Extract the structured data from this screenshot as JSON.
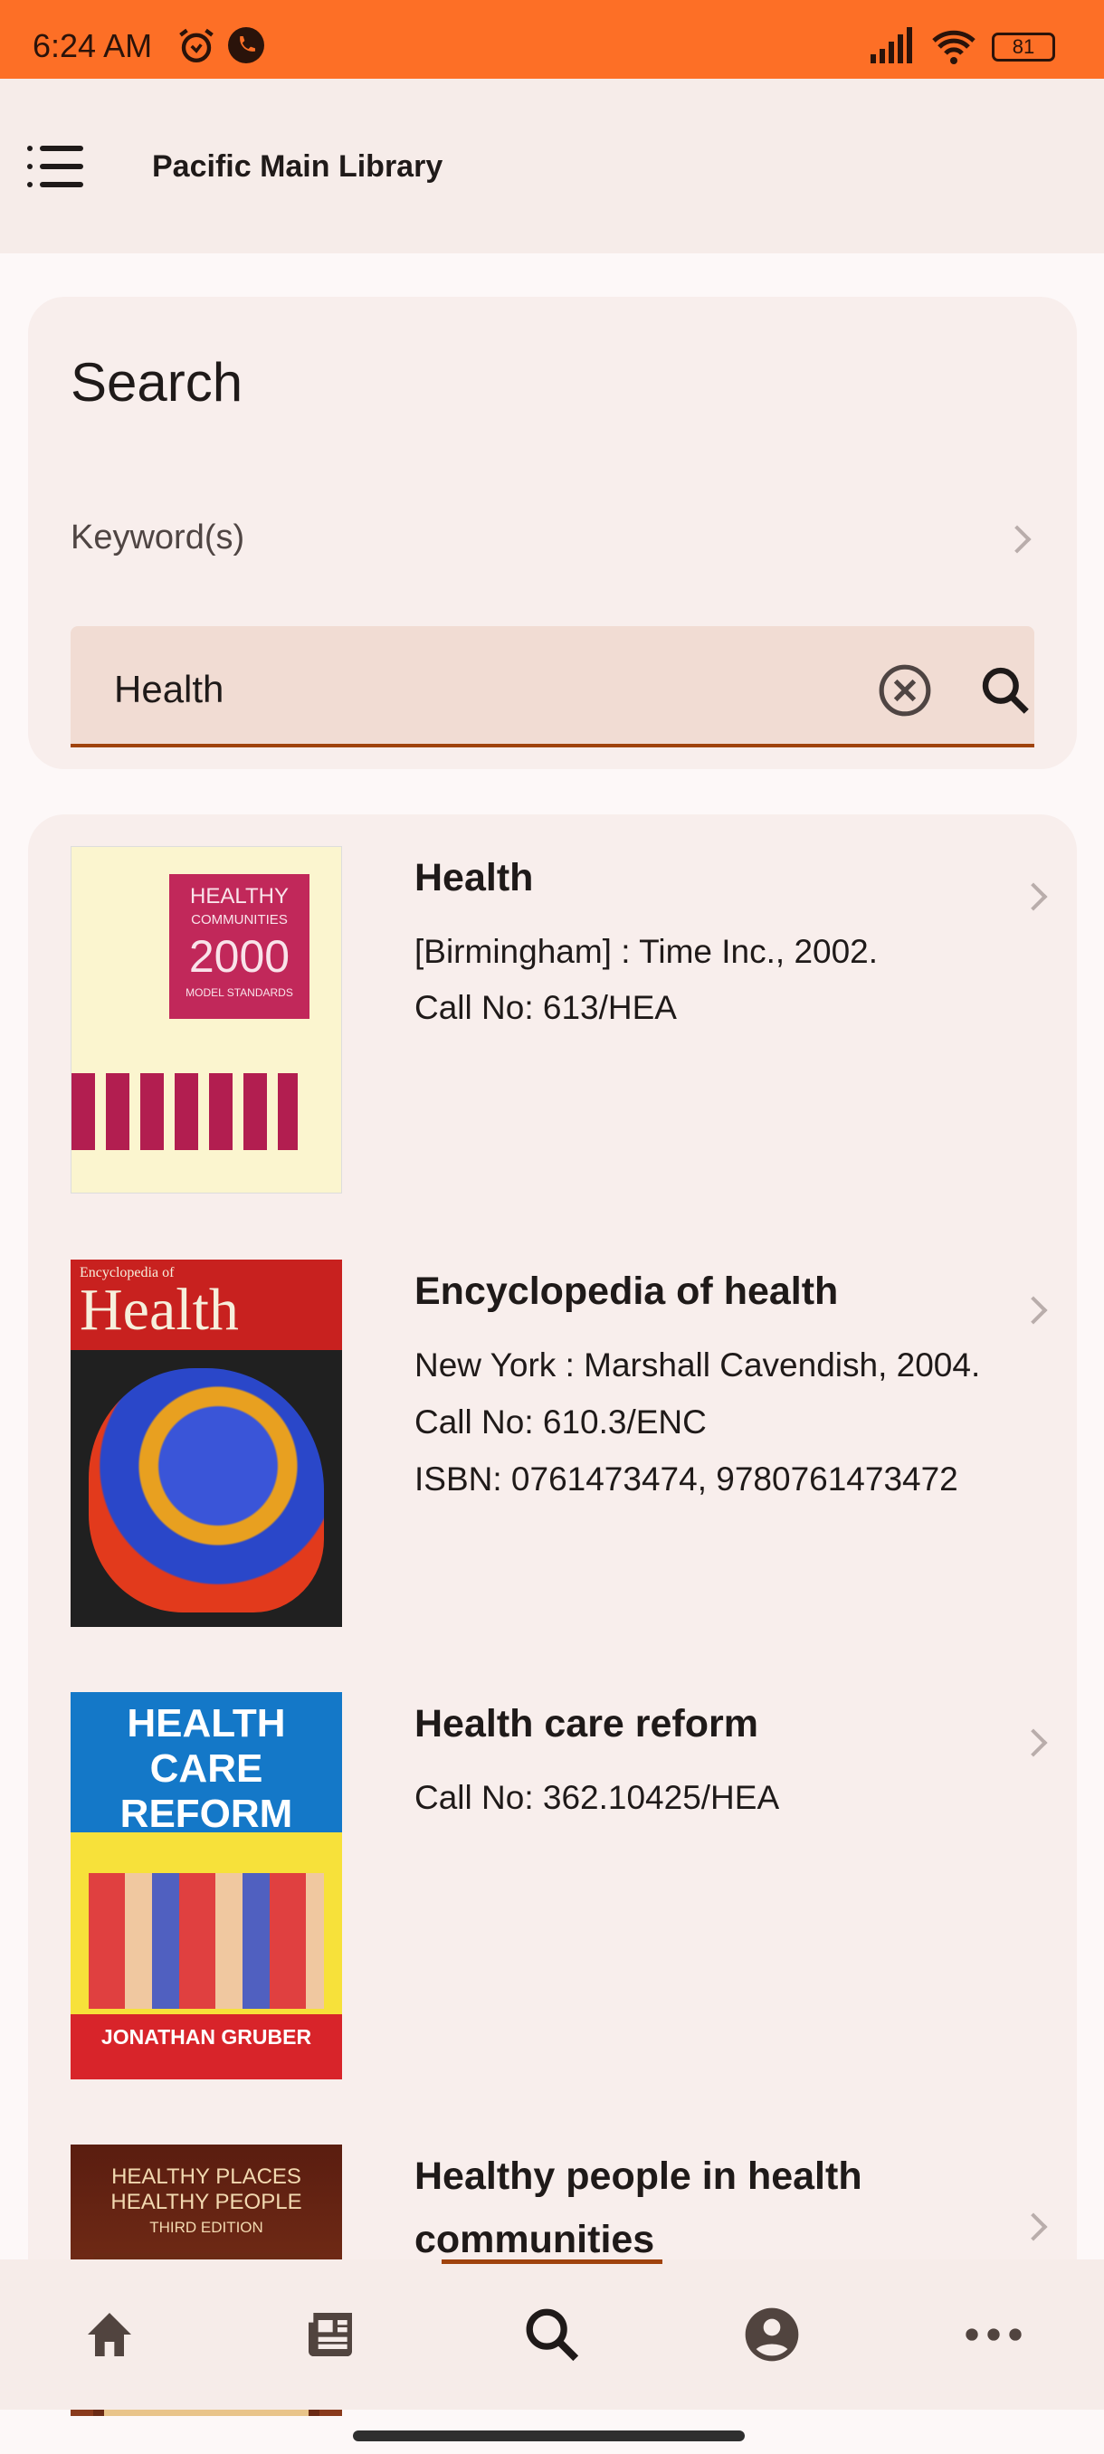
{
  "status_bar": {
    "time": "6:24 AM",
    "battery": "81",
    "icons": [
      "alarm-icon",
      "call-icon",
      "signal-icon",
      "wifi-icon",
      "battery-icon"
    ]
  },
  "app_bar": {
    "title": "Pacific Main Library",
    "menu_icon": "menu-list-icon"
  },
  "search": {
    "heading": "Search",
    "field_label": "Keyword(s)",
    "query": "Health"
  },
  "results": [
    {
      "title": "Health",
      "lines": [
        "[Birmingham] : Time Inc., 2002.",
        "Call No: 613/HEA"
      ],
      "cover_text": [
        "HEALTHY",
        "COMMUNITIES",
        "2000",
        "MODEL STANDARDS"
      ]
    },
    {
      "title": "Encyclopedia of health",
      "lines": [
        "New York : Marshall Cavendish, 2004.",
        "Call No: 610.3/ENC",
        "ISBN: 0761473474, 9780761473472"
      ],
      "cover_text": [
        "Encyclopedia of",
        "Health"
      ]
    },
    {
      "title": "Health care reform",
      "lines": [
        "Call No: 362.10425/HEA"
      ],
      "cover_text": [
        "HEALTH",
        "CARE",
        "REFORM",
        "JONATHAN GRUBER"
      ]
    },
    {
      "title": "Healthy people in health communities",
      "lines": [],
      "cover_text": [
        "HEALTHY PLACES",
        "HEALTHY PEOPLE",
        "THIRD EDITION"
      ]
    }
  ],
  "bottom_nav": [
    {
      "icon": "home-icon"
    },
    {
      "icon": "news-icon"
    },
    {
      "icon": "search-icon",
      "active": true
    },
    {
      "icon": "account-icon"
    },
    {
      "icon": "more-icon"
    }
  ],
  "colors": {
    "status_bar": "#fd6f26",
    "accent": "#a0430c",
    "surface": "#f6ece9"
  }
}
